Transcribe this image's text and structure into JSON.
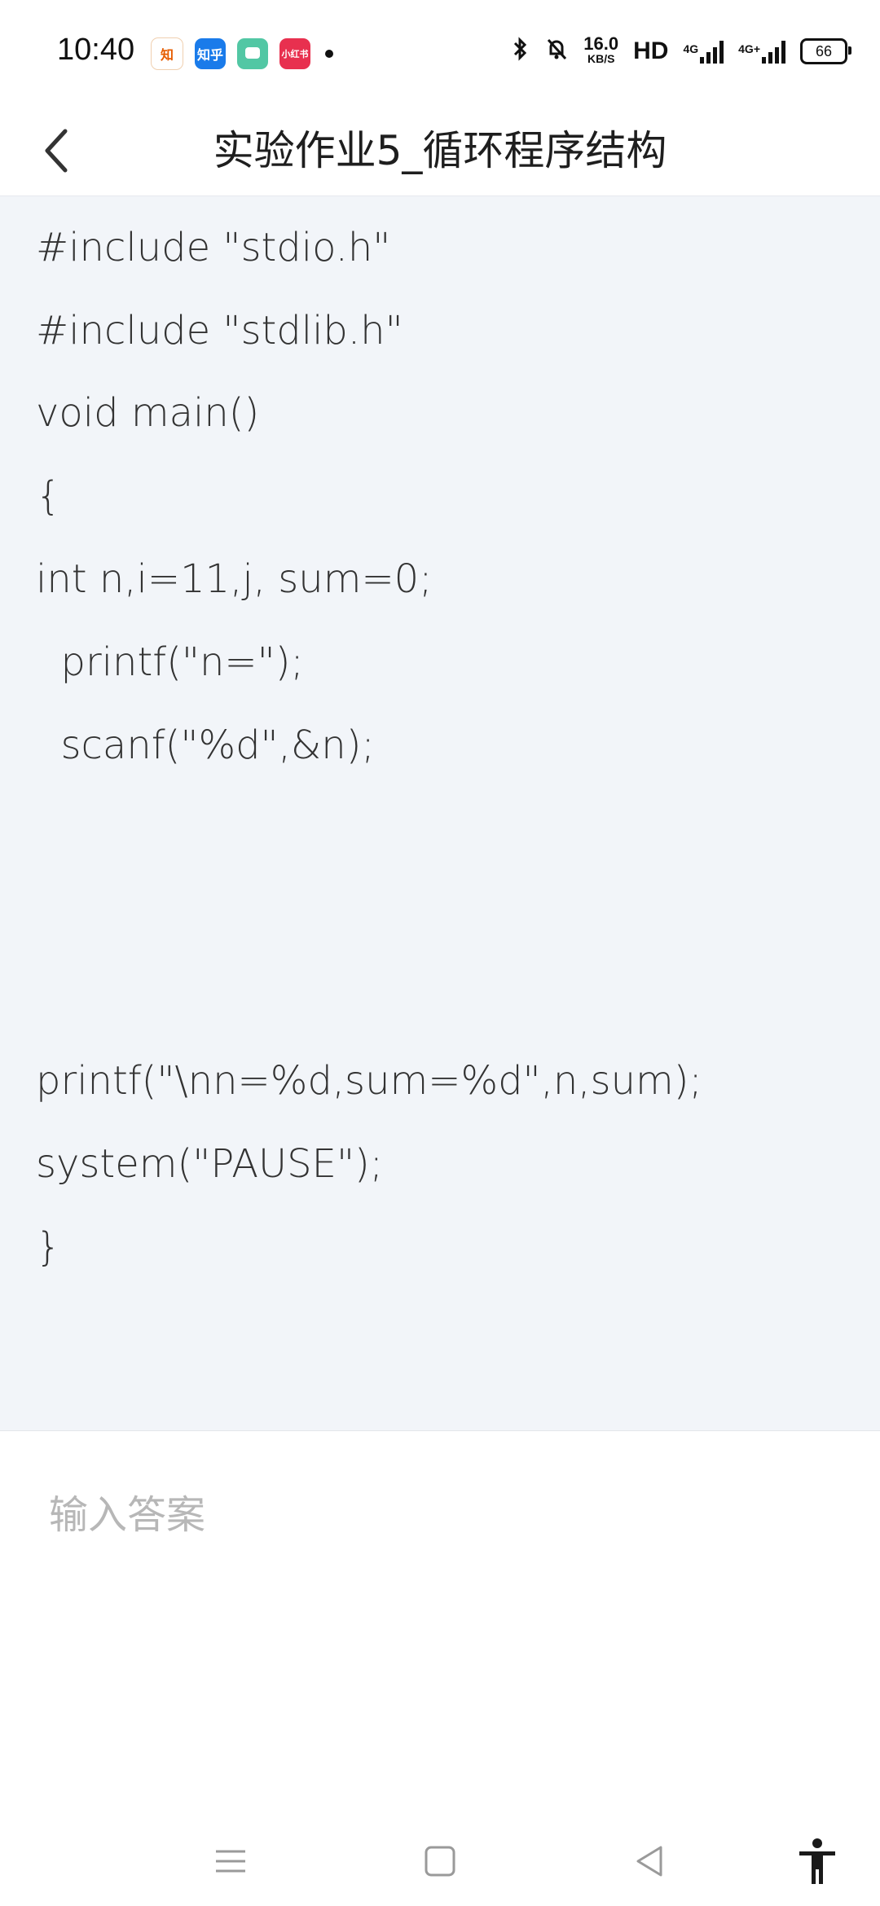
{
  "status_bar": {
    "time": "10:40",
    "apps": [
      "知",
      "知乎",
      "",
      "小红书"
    ],
    "speed_value": "16.0",
    "speed_unit": "KB/S",
    "hd": "HD",
    "signal1_label": "4G",
    "signal2_label": "4G+",
    "battery": "66"
  },
  "header": {
    "title": "实验作业5_循环程序结构"
  },
  "code": {
    "lines": [
      "#include \"stdio.h\"",
      "#include \"stdlib.h\"",
      "void main()",
      "{",
      "int n,i=11,j, sum=0;",
      "  printf(\"n=\");",
      "  scanf(\"%d\",&n);",
      "printf(\"\\nn=%d,sum=%d\",n,sum);",
      "system(\"PAUSE\");",
      "}"
    ]
  },
  "answer": {
    "placeholder": "输入答案"
  },
  "icons": {
    "back": "chevron-left-icon",
    "menu": "menu-icon",
    "home": "home-square-icon",
    "nav_back": "triangle-back-icon",
    "accessibility": "accessibility-icon"
  }
}
